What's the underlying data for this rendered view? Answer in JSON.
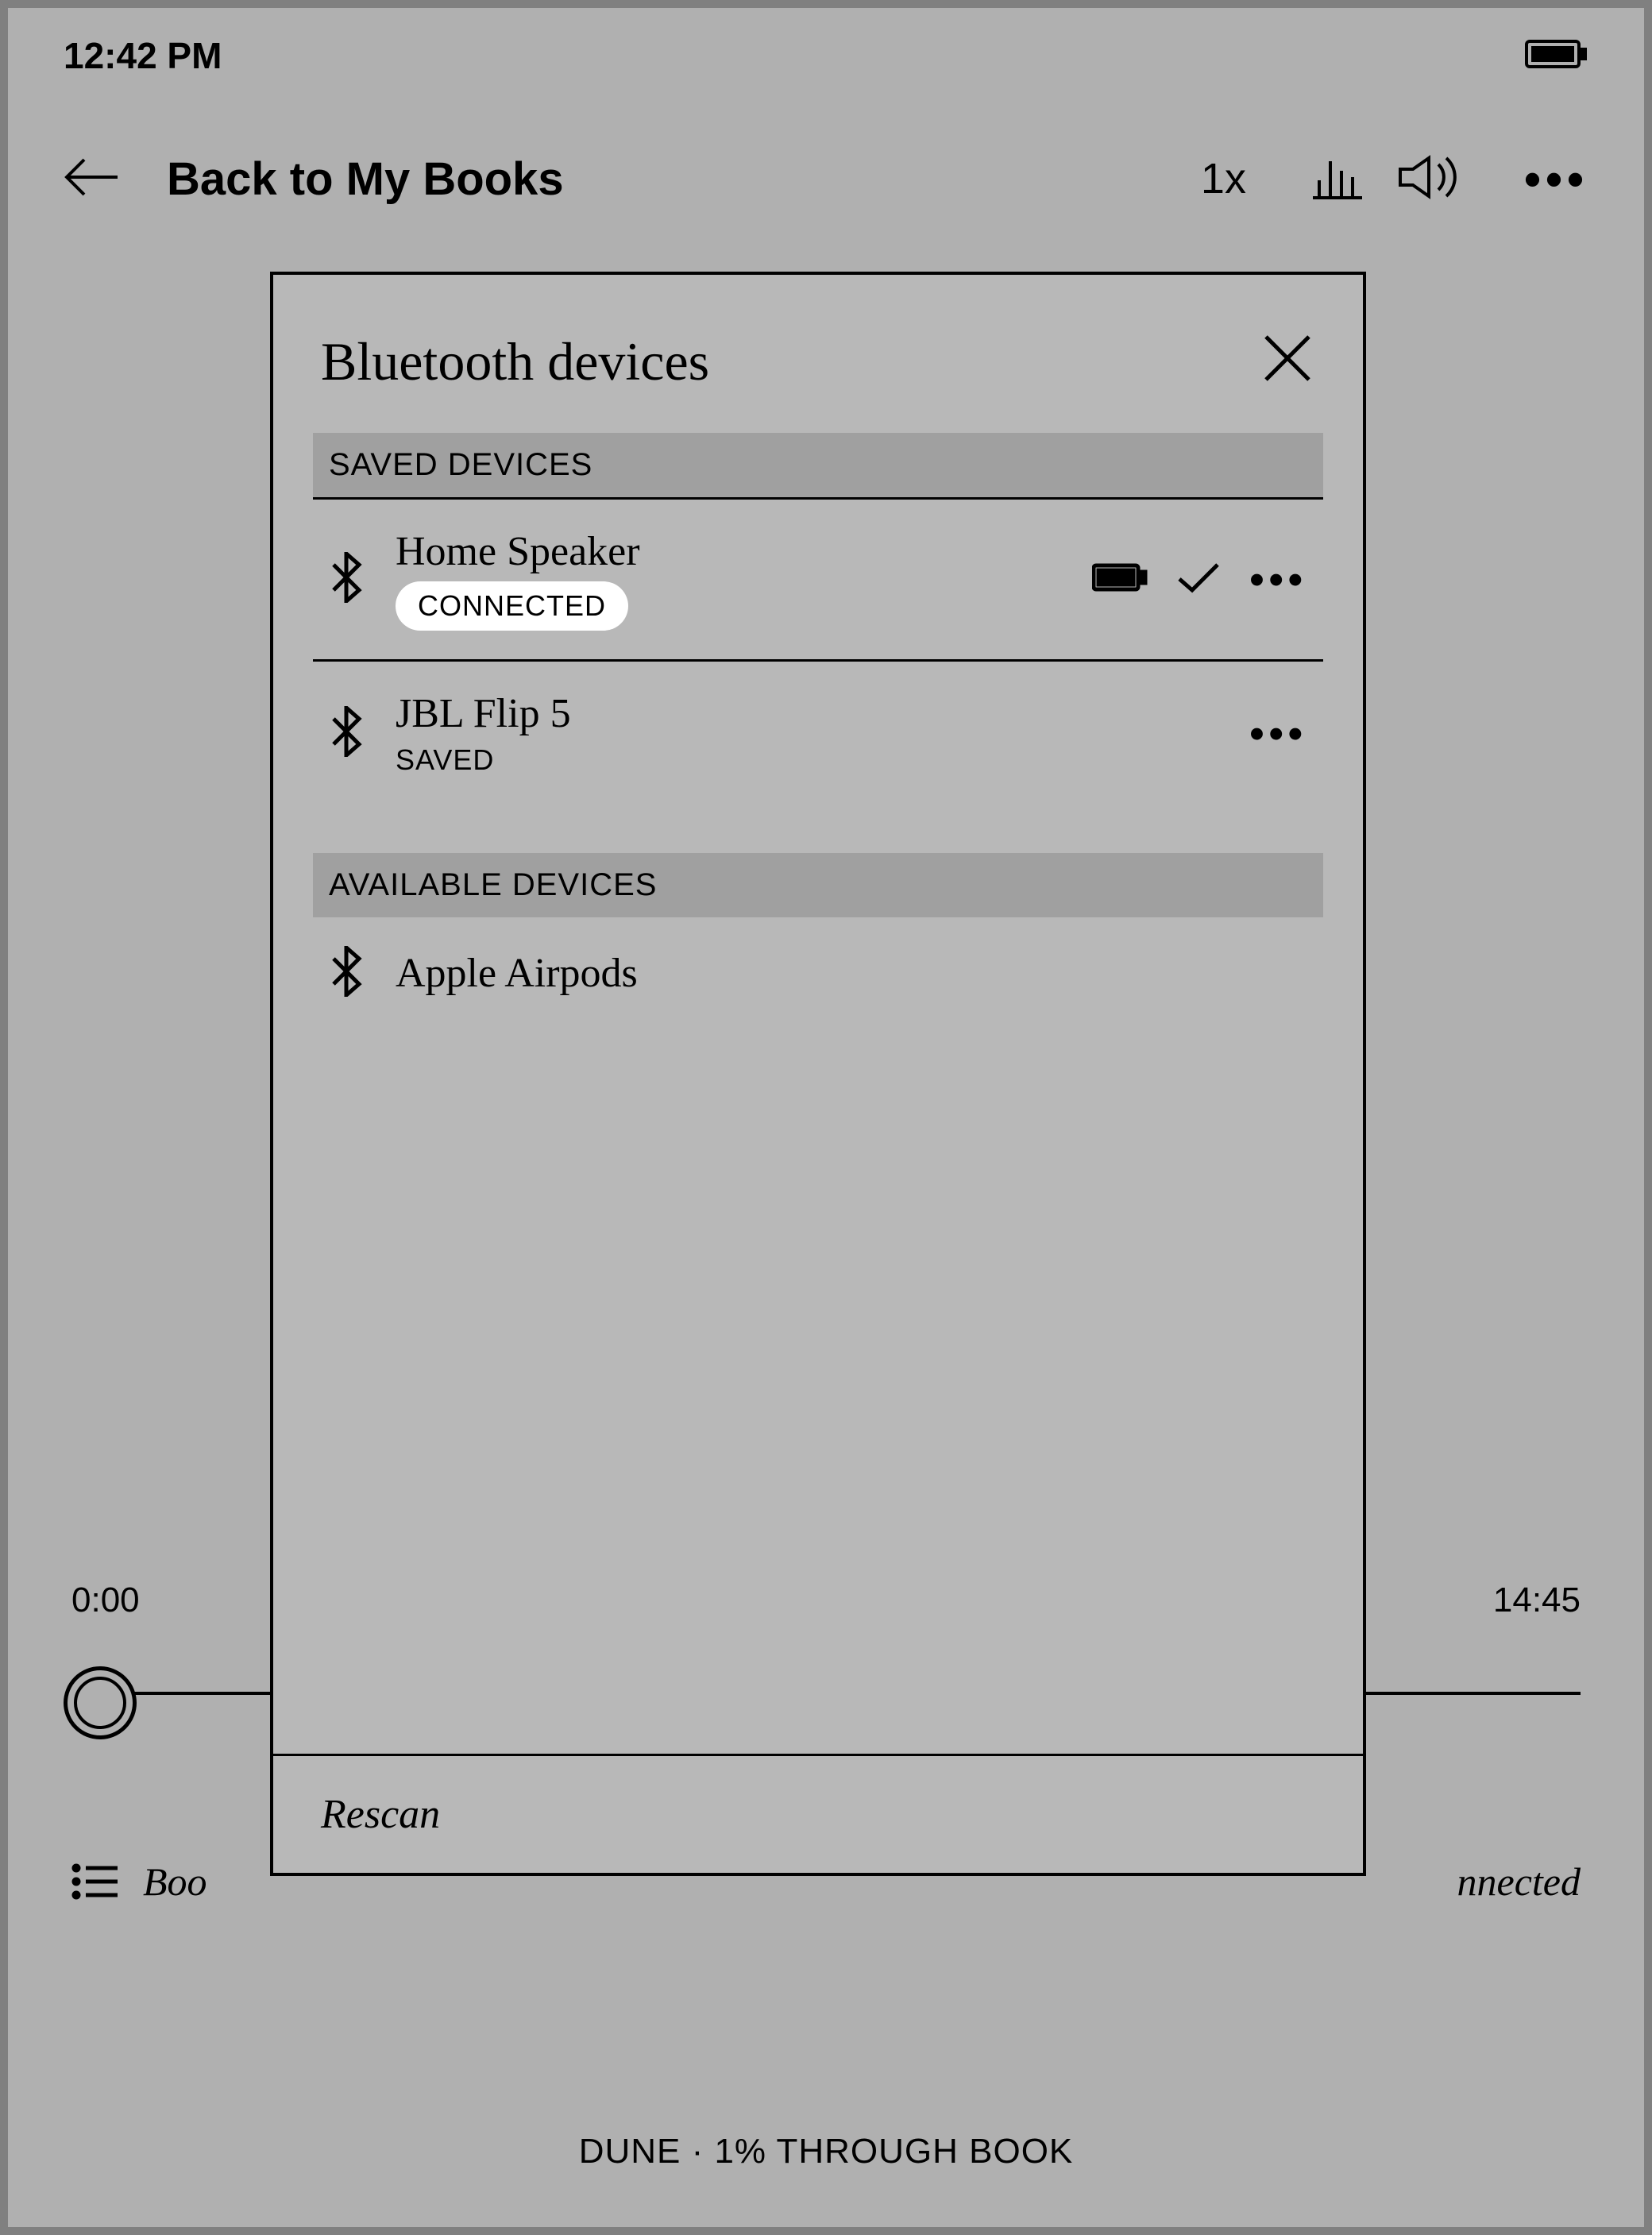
{
  "status": {
    "time": "12:42 PM"
  },
  "toolbar": {
    "back_label": "Back to My Books",
    "speed_label": "1x"
  },
  "player": {
    "elapsed": "0:00",
    "remaining": "14:45",
    "chapter_left": "Boo",
    "chapter_right": "nnected"
  },
  "footer": {
    "text": "DUNE · 1% THROUGH BOOK"
  },
  "dialog": {
    "title": "Bluetooth devices",
    "saved_header": "SAVED DEVICES",
    "available_header": "AVAILABLE DEVICES",
    "rescan_label": "Rescan",
    "saved": [
      {
        "name": "Home Speaker",
        "status": "CONNECTED",
        "connected": true
      },
      {
        "name": "JBL Flip 5",
        "status": "SAVED",
        "connected": false
      }
    ],
    "available": [
      {
        "name": "Apple Airpods"
      }
    ]
  }
}
